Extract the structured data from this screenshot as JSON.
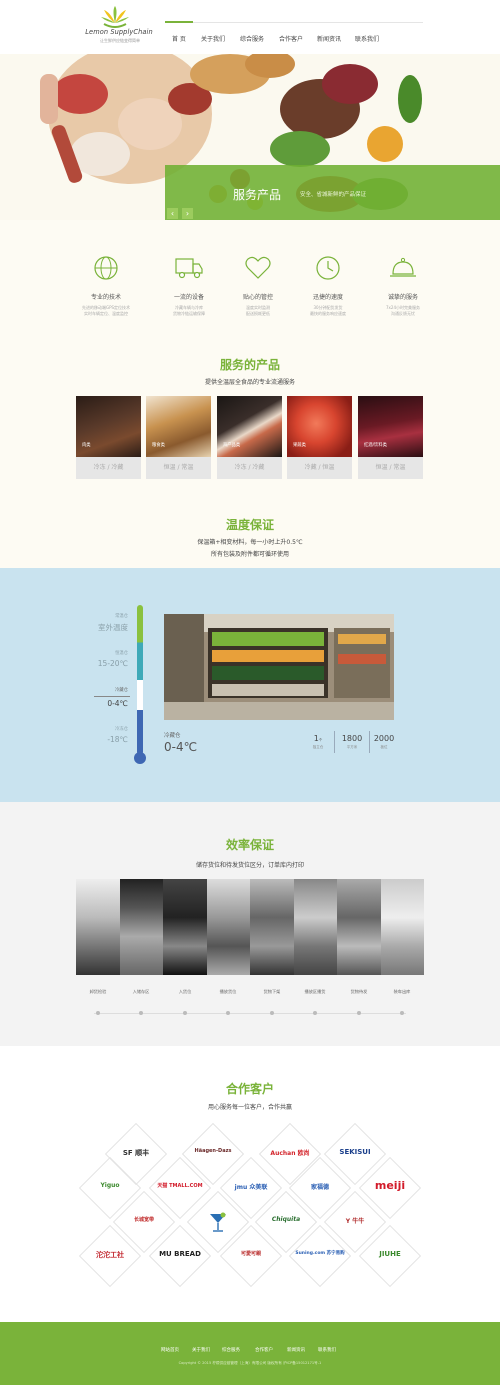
{
  "brand": {
    "name": "Lemon SupplyChain",
    "tagline": "让生鲜供应链变得简单"
  },
  "nav": {
    "items": [
      "首 页",
      "关于我们",
      "综合服务",
      "合作客户",
      "新闻资讯",
      "联系我们"
    ],
    "active": "首 页"
  },
  "banner": {
    "title": "服务产品",
    "subtitle": "安全、省城新鲜的产品保证",
    "prev": "‹",
    "next": "›"
  },
  "features": [
    {
      "icon": "globe-icon",
      "title": "专业的技术",
      "desc": [
        "先进的移动端GPS定位技术",
        "实时车辆定位、温度监控"
      ]
    },
    {
      "icon": "truck-icon",
      "title": "一流的设备",
      "desc": [
        "冷藏车辆与冷库",
        "货物冷链运输保障"
      ]
    },
    {
      "icon": "heart-icon",
      "title": "贴心的管控",
      "desc": [
        "温度实时监测",
        "配送损耗更低"
      ]
    },
    {
      "icon": "clock-icon",
      "title": "迅捷的速度",
      "desc": [
        "30分钟配货发货",
        "最快的服务响应速度"
      ]
    },
    {
      "icon": "cloche-icon",
      "title": "诚挚的服务",
      "desc": [
        "7x24小时完美服务",
        "沟通反馈无忧"
      ]
    }
  ],
  "products": {
    "title": "服务的产品",
    "subtitle": "提供全温层全食品的专业流通服务",
    "items": [
      {
        "label": "肉类",
        "temp": "冷冻 / 冷藏",
        "color": "#5a3a2a"
      },
      {
        "label": "粮食类",
        "temp": "恒温 / 常温",
        "color": "#b07a45"
      },
      {
        "label": "海产品类",
        "temp": "冷冻 / 冷藏",
        "color": "#3a2e2a"
      },
      {
        "label": "果蔬类",
        "temp": "冷藏 / 恒温",
        "color": "#c8503a"
      },
      {
        "label": "红酒/饮料类",
        "temp": "恒温 / 常温",
        "color": "#5a1a24"
      }
    ]
  },
  "temperature": {
    "title": "温度保证",
    "lines": [
      "保温箱+相变材料，每一小时上升0.5℃",
      "所有包装及附件都可循环使用"
    ],
    "zones": [
      {
        "caption": "常温仓",
        "value": "室外温度"
      },
      {
        "caption": "恒温仓",
        "value": "15-20℃"
      },
      {
        "caption": "冷藏仓",
        "value": "0-4℃"
      },
      {
        "caption": "冷冻仓",
        "value": "-18℃"
      }
    ],
    "store_caption": "冷藏仓",
    "store_value": "0-4℃",
    "stats": [
      {
        "num": "1",
        "sup": "个",
        "unit": "独立仓"
      },
      {
        "num": "1800",
        "sup": "",
        "unit": "平方米"
      },
      {
        "num": "2000",
        "sup": "",
        "unit": "板位"
      }
    ]
  },
  "efficiency": {
    "title": "效率保证",
    "subtitle": "储存货位和待发货位区分，订单库内打印",
    "steps": [
      "卸货检验",
      "入储存区",
      "入货位",
      "播放货位",
      "货物下架",
      "播放区播货",
      "货物待发",
      "装车出库"
    ]
  },
  "partners": {
    "title": "合作客户",
    "subtitle": "用心服务每一位客户，合作共赢",
    "logos": [
      {
        "name": "SF 顺丰",
        "color": "#333"
      },
      {
        "name": "Häagen-Dazs",
        "color": "#6b2a2a"
      },
      {
        "name": "Auchan 欧尚",
        "color": "#d3232a"
      },
      {
        "name": "SEKISUI",
        "color": "#1b3f8b"
      },
      {
        "name": "Yiguo",
        "color": "#3c8a2e"
      },
      {
        "name": "天猫 TMALL.COM",
        "color": "#d21b2a"
      },
      {
        "name": "jmu 众美联",
        "color": "#2a5fb4"
      },
      {
        "name": "家福德",
        "color": "#2a5fb4"
      },
      {
        "name": "meiji",
        "color": "#d21b2a"
      },
      {
        "name": "长城宽带",
        "color": "#c02a2a"
      },
      {
        "name": "Chiquita",
        "color": "#2a6f30"
      },
      {
        "name": "Y 牛牛",
        "color": "#b02a2a"
      },
      {
        "name": "沱沱工社",
        "color": "#c0222a"
      },
      {
        "name": "MU BREAD",
        "color": "#222"
      },
      {
        "name": "可愛可親",
        "color": "#b82a2a"
      },
      {
        "name": "Suning.com 苏宁易购",
        "color": "#2a5fb4"
      },
      {
        "name": "JIUHE",
        "color": "#3c8a2e"
      }
    ]
  },
  "footer": {
    "links": [
      "网站首页",
      "关于我们",
      "综合服务",
      "合作客户",
      "新闻资讯",
      "联系我们"
    ],
    "copyright": "Copyright © 2015 柠檬供应链管理（上海）有限公司 版权所有  沪ICP备15012171号-1"
  },
  "colors": {
    "accent": "#7ab33a",
    "temp_panel": "#c9e3ef",
    "footer": "#7ab33a"
  }
}
